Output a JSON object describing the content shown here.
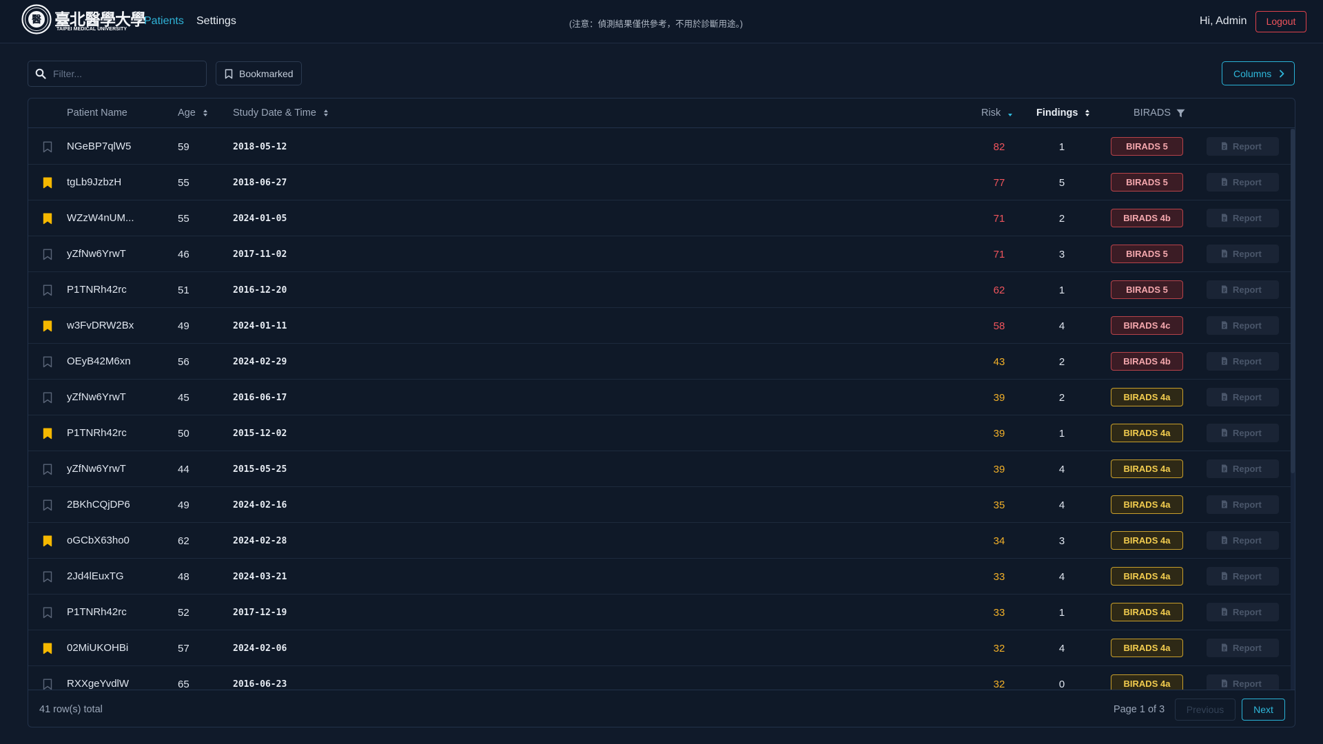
{
  "header": {
    "logo_cn": "臺北醫學大學",
    "logo_en": "TAIPEI MEDICAL UNIVERSITY",
    "seal_glyph": "醫",
    "nav": {
      "patients": "Patients",
      "settings": "Settings"
    },
    "notice": "(注意：偵測結果僅供參考，不用於診斷用途。)",
    "greeting": "Hi, Admin",
    "logout": "Logout"
  },
  "toolbar": {
    "filter_placeholder": "Filter...",
    "bookmarked_label": "Bookmarked",
    "columns_label": "Columns"
  },
  "table": {
    "columns": {
      "name": "Patient Name",
      "age": "Age",
      "date": "Study Date & Time",
      "risk": "Risk",
      "findings": "Findings",
      "birads": "BIRADS"
    },
    "sort": {
      "column": "Risk",
      "direction": "descending"
    },
    "report_label": "Report",
    "rows": [
      {
        "bookmarked": false,
        "name": "NGeBP7qlW5",
        "age": "59",
        "date": "2018-05-12",
        "risk": "82",
        "findings": "1",
        "birads": "BIRADS 5"
      },
      {
        "bookmarked": true,
        "name": "tgLb9JzbzH",
        "age": "55",
        "date": "2018-06-27",
        "risk": "77",
        "findings": "5",
        "birads": "BIRADS 5"
      },
      {
        "bookmarked": true,
        "name": "WZzW4nUM...",
        "age": "55",
        "date": "2024-01-05",
        "risk": "71",
        "findings": "2",
        "birads": "BIRADS 4b"
      },
      {
        "bookmarked": false,
        "name": "yZfNw6YrwT",
        "age": "46",
        "date": "2017-11-02",
        "risk": "71",
        "findings": "3",
        "birads": "BIRADS 5"
      },
      {
        "bookmarked": false,
        "name": "P1TNRh42rc",
        "age": "51",
        "date": "2016-12-20",
        "risk": "62",
        "findings": "1",
        "birads": "BIRADS 5"
      },
      {
        "bookmarked": true,
        "name": "w3FvDRW2Bx",
        "age": "49",
        "date": "2024-01-11",
        "risk": "58",
        "findings": "4",
        "birads": "BIRADS 4c"
      },
      {
        "bookmarked": false,
        "name": "OEyB42M6xn",
        "age": "56",
        "date": "2024-02-29",
        "risk": "43",
        "findings": "2",
        "birads": "BIRADS 4b"
      },
      {
        "bookmarked": false,
        "name": "yZfNw6YrwT",
        "age": "45",
        "date": "2016-06-17",
        "risk": "39",
        "findings": "2",
        "birads": "BIRADS 4a"
      },
      {
        "bookmarked": true,
        "name": "P1TNRh42rc",
        "age": "50",
        "date": "2015-12-02",
        "risk": "39",
        "findings": "1",
        "birads": "BIRADS 4a"
      },
      {
        "bookmarked": false,
        "name": "yZfNw6YrwT",
        "age": "44",
        "date": "2015-05-25",
        "risk": "39",
        "findings": "4",
        "birads": "BIRADS 4a"
      },
      {
        "bookmarked": false,
        "name": "2BKhCQjDP6",
        "age": "49",
        "date": "2024-02-16",
        "risk": "35",
        "findings": "4",
        "birads": "BIRADS 4a"
      },
      {
        "bookmarked": true,
        "name": "oGCbX63ho0",
        "age": "62",
        "date": "2024-02-28",
        "risk": "34",
        "findings": "3",
        "birads": "BIRADS 4a"
      },
      {
        "bookmarked": false,
        "name": "2Jd4lEuxTG",
        "age": "48",
        "date": "2024-03-21",
        "risk": "33",
        "findings": "4",
        "birads": "BIRADS 4a"
      },
      {
        "bookmarked": false,
        "name": "P1TNRh42rc",
        "age": "52",
        "date": "2017-12-19",
        "risk": "33",
        "findings": "1",
        "birads": "BIRADS 4a"
      },
      {
        "bookmarked": true,
        "name": "02MiUKOHBi",
        "age": "57",
        "date": "2024-02-06",
        "risk": "32",
        "findings": "4",
        "birads": "BIRADS 4a"
      },
      {
        "bookmarked": false,
        "name": "RXXgeYvdlW",
        "age": "65",
        "date": "2016-06-23",
        "risk": "32",
        "findings": "0",
        "birads": "BIRADS 4a"
      }
    ]
  },
  "footer": {
    "total": "41 row(s) total",
    "page_info": "Page 1 of 3",
    "previous": "Previous",
    "next": "Next"
  },
  "colors": {
    "accent": "#2fb9dc",
    "logout": "#f0545c",
    "bookmark_on": "#f5b800",
    "risk_high": "#f0545c",
    "risk_mid": "#f2b028",
    "birads_high": "#f4a7ad",
    "birads_mid": "#f2cc4e"
  }
}
